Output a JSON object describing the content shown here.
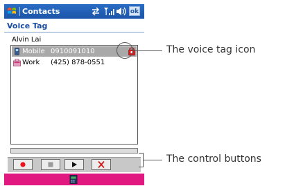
{
  "titlebar": {
    "app_title": "Contacts",
    "ok_label": "ok"
  },
  "status_icons": [
    "connectivity-icon",
    "signal-icon",
    "speaker-icon"
  ],
  "page": {
    "title": "Voice Tag"
  },
  "contact": {
    "name": "Alvin Lai"
  },
  "numbers": [
    {
      "label": "Mobile",
      "value": "0910091010",
      "icon": "mobile-phone-icon",
      "selected": true,
      "has_voice_tag": true
    },
    {
      "label": "Work",
      "value": "(425) 878-0551",
      "icon": "work-phone-icon",
      "selected": false,
      "has_voice_tag": false
    }
  ],
  "playback_progress": 0,
  "controls": [
    "record-icon",
    "stop-icon",
    "play-icon",
    "delete-icon"
  ],
  "annotations": {
    "voice_tag": "The voice tag icon",
    "controls": "The control buttons"
  },
  "colors": {
    "titlebar": "#1b55a8",
    "heading": "#1c4fa3",
    "selection": "#a9a9a9",
    "bottombar": "#e0187f",
    "record": "#e8141e",
    "delete": "#d01818"
  }
}
